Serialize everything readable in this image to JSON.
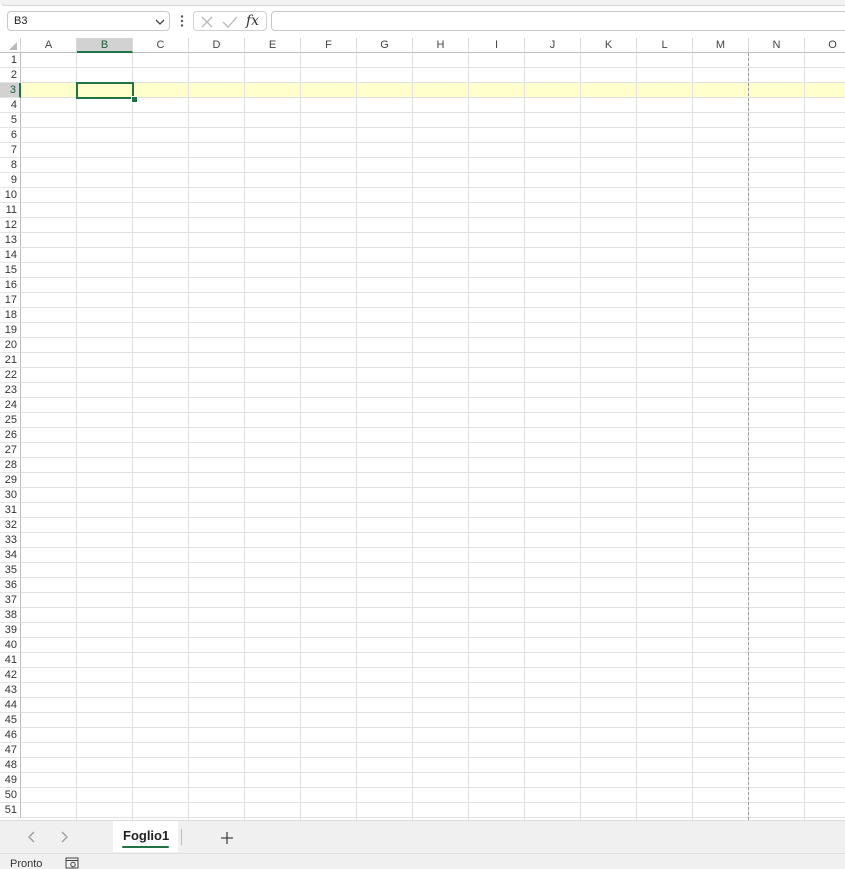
{
  "formula_bar": {
    "name_box_value": "B3",
    "fx_label": "fx",
    "formula_value": ""
  },
  "grid": {
    "columns": [
      "A",
      "B",
      "C",
      "D",
      "E",
      "F",
      "G",
      "H",
      "I",
      "J",
      "K",
      "L",
      "M",
      "N",
      "O"
    ],
    "rows": [
      "1",
      "2",
      "3",
      "4",
      "5",
      "6",
      "7",
      "8",
      "9",
      "10",
      "11",
      "12",
      "13",
      "14",
      "15",
      "16",
      "17",
      "18",
      "19",
      "20",
      "21",
      "22",
      "23",
      "24",
      "25",
      "26",
      "27",
      "28",
      "29",
      "30",
      "31",
      "32",
      "33",
      "34",
      "35",
      "36",
      "37",
      "38",
      "39",
      "40",
      "41",
      "42",
      "43",
      "44",
      "45",
      "46",
      "47",
      "48",
      "49",
      "50",
      "51"
    ],
    "active_cell": "B3",
    "active_column": "B",
    "active_row": "3",
    "colors": {
      "accent": "#217346",
      "row_highlight": "#ffffcc",
      "gridline": "#e1e1e1"
    }
  },
  "sheet_tabs": {
    "tabs": [
      {
        "label": "Foglio1",
        "active": true
      }
    ],
    "icons": [
      "chevron-left-icon",
      "chevron-right-icon",
      "plus-icon"
    ]
  },
  "status_bar": {
    "status_text": "Pronto",
    "icon": "accessibility-icon"
  }
}
